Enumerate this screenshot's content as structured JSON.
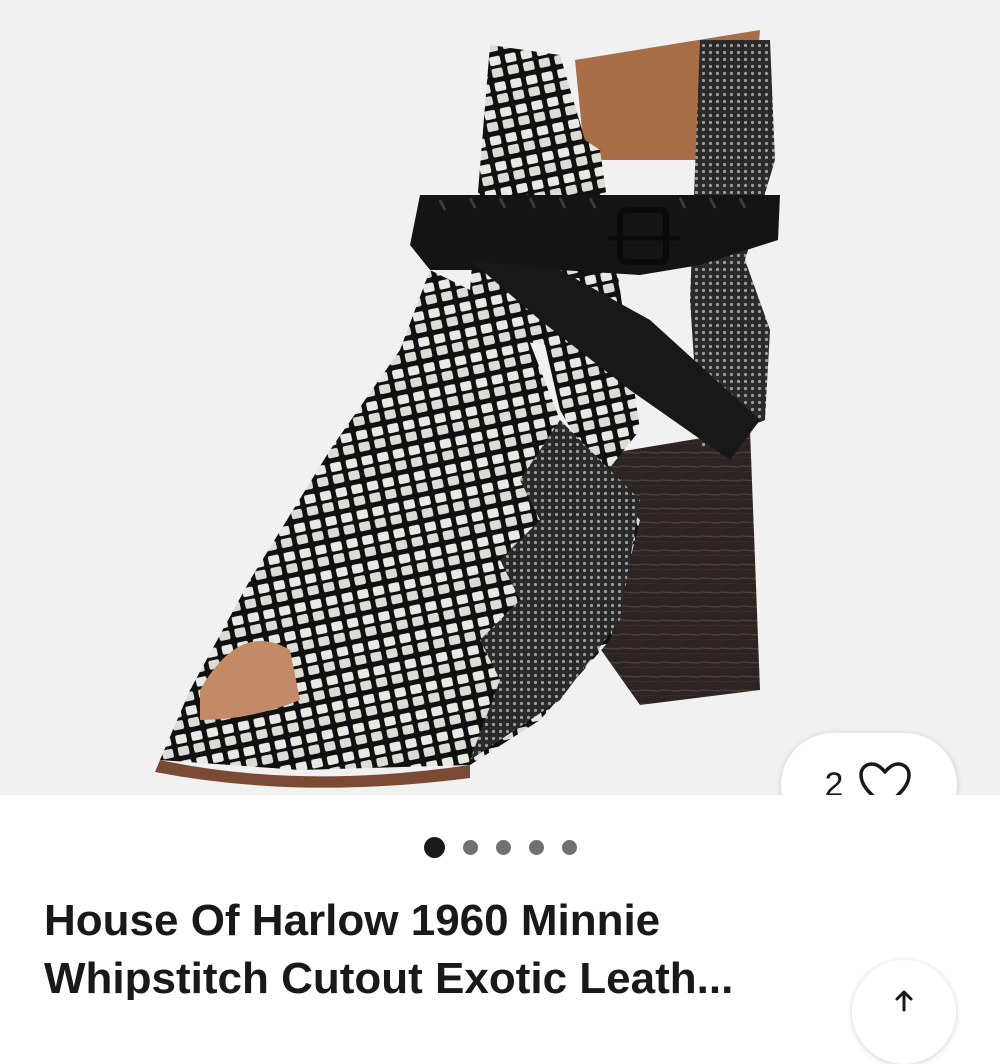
{
  "product": {
    "title": "House Of Harlow 1960 Minnie Whipstitch Cutout Exotic Leath...",
    "image_alt": "Black and white snake print peep toe bootie with strap and stacked heel"
  },
  "gallery": {
    "total_images": 5,
    "active_index": 0
  },
  "watch": {
    "count": "2",
    "icon": "heart-icon"
  },
  "colors": {
    "text": "#191919",
    "background": "#f1f1f1",
    "dot_active": "#191919",
    "dot_inactive": "#707070"
  }
}
